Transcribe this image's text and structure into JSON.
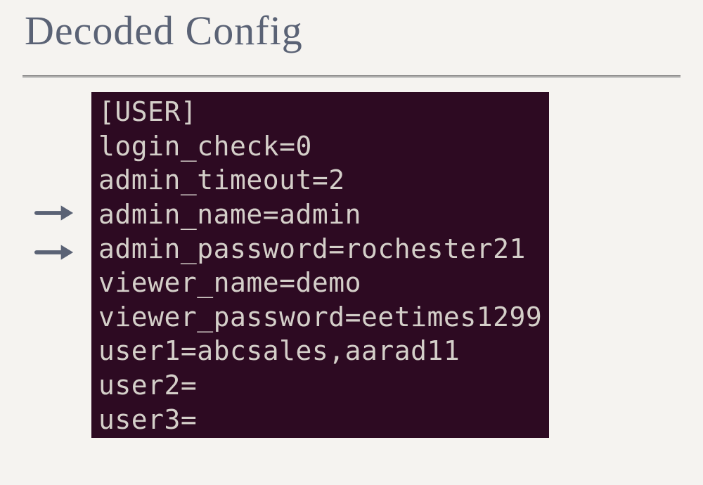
{
  "slide": {
    "title": "Decoded Config"
  },
  "config": {
    "lines": [
      "[USER]",
      "login_check=0",
      "admin_timeout=2",
      "admin_name=admin",
      "admin_password=rochester21",
      "viewer_name=demo",
      "viewer_password=eetimes1299",
      "user1=abcsales,aarad11",
      "user2=",
      "user3="
    ]
  }
}
